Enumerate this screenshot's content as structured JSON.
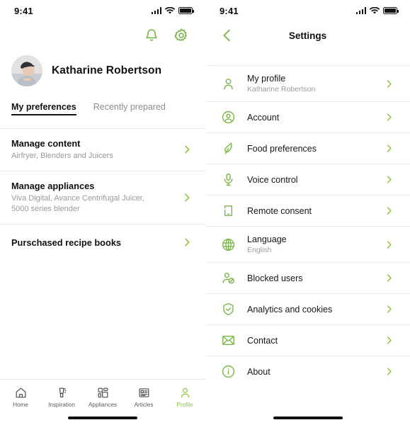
{
  "theme": {
    "green": "#7ab648",
    "green_light": "#8cc63e",
    "text": "#111111",
    "muted": "#9a9a9a",
    "divider": "#ececec"
  },
  "left_screen": {
    "status_bar": {
      "time": "9:41",
      "signal_icon": "cellular-signal-icon",
      "wifi_icon": "wifi-icon",
      "battery_icon": "battery-icon"
    },
    "top_actions": [
      {
        "name": "notifications-bell-icon",
        "label": "Notifications"
      },
      {
        "name": "settings-gear-icon",
        "label": "Settings"
      }
    ],
    "profile": {
      "name": "Katharine Robertson",
      "avatar_icon": "user-avatar-photo"
    },
    "tabs": [
      {
        "label": "My preferences",
        "active": true
      },
      {
        "label": "Recently prepared",
        "active": false
      }
    ],
    "preferences": [
      {
        "title": "Manage content",
        "subtitle": "Airfryer, Blenders and Juicers",
        "chevron": "chevron-right-icon"
      },
      {
        "title": "Manage appliances",
        "subtitle": "Viva Digital, Avance Centrifugal Juicer, 5000 series blender",
        "chevron": "chevron-right-icon"
      },
      {
        "title": "Purschased recipe books",
        "subtitle": "",
        "chevron": "chevron-right-icon"
      }
    ],
    "bottom_nav": [
      {
        "label": "Home",
        "icon": "home-icon",
        "active": false
      },
      {
        "label": "Inspiration",
        "icon": "blender-inspiration-icon",
        "active": false
      },
      {
        "label": "Appliances",
        "icon": "grid-appliances-icon",
        "active": false
      },
      {
        "label": "Articles",
        "icon": "article-document-icon",
        "active": false
      },
      {
        "label": "Profile",
        "icon": "person-profile-icon",
        "active": true
      }
    ]
  },
  "right_screen": {
    "status_bar": {
      "time": "9:41",
      "signal_icon": "cellular-signal-icon",
      "wifi_icon": "wifi-icon",
      "battery_icon": "battery-icon"
    },
    "header": {
      "back_icon": "chevron-left-back-icon",
      "title": "Settings"
    },
    "settings_items": [
      {
        "label": "My profile",
        "sublabel": "Katharine Robertson",
        "icon": "person-icon",
        "chevron": "chevron-right-icon"
      },
      {
        "label": "Account",
        "sublabel": "",
        "icon": "account-circle-icon",
        "chevron": "chevron-right-icon"
      },
      {
        "label": "Food preferences",
        "sublabel": "",
        "icon": "leaf-food-icon",
        "chevron": "chevron-right-icon"
      },
      {
        "label": "Voice control",
        "sublabel": "",
        "icon": "microphone-icon",
        "chevron": "chevron-right-icon"
      },
      {
        "label": "Remote consent",
        "sublabel": "",
        "icon": "phone-remote-icon",
        "chevron": "chevron-right-icon"
      },
      {
        "label": "Language",
        "sublabel": "English",
        "icon": "globe-language-icon",
        "chevron": "chevron-right-icon"
      },
      {
        "label": "Blocked users",
        "sublabel": "",
        "icon": "blocked-user-icon",
        "chevron": "chevron-right-icon"
      },
      {
        "label": "Analytics and cookies",
        "sublabel": "",
        "icon": "shield-check-icon",
        "chevron": "chevron-right-icon"
      },
      {
        "label": "Contact",
        "sublabel": "",
        "icon": "envelope-mail-icon",
        "chevron": "chevron-right-icon"
      },
      {
        "label": "About",
        "sublabel": "",
        "icon": "info-circle-icon",
        "chevron": "chevron-right-icon"
      }
    ]
  }
}
